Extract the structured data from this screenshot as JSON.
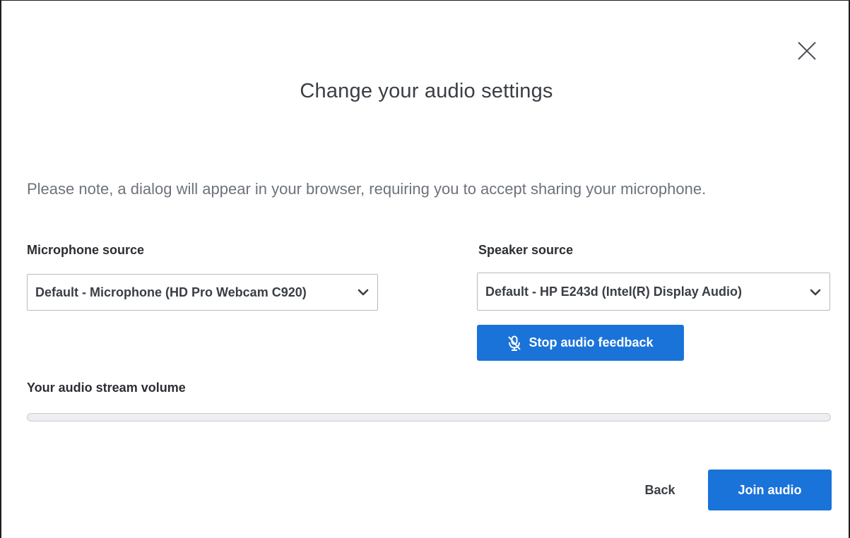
{
  "dialog": {
    "title": "Change your audio settings",
    "note": "Please note, a dialog will appear in your browser, requiring you to accept sharing your microphone.",
    "close_icon": "close-icon"
  },
  "microphone": {
    "label": "Microphone source",
    "selected": "Default - Microphone (HD Pro Webcam C920)",
    "chevron_icon": "chevron-down-icon"
  },
  "speaker": {
    "label": "Speaker source",
    "selected": "Default - HP E243d (Intel(R) Display Audio)",
    "chevron_icon": "chevron-down-icon"
  },
  "feedback_button": {
    "label": "Stop audio feedback",
    "icon": "mic-off-icon"
  },
  "volume": {
    "label": "Your audio stream volume",
    "level": 0
  },
  "footer": {
    "back_label": "Back",
    "join_label": "Join audio"
  },
  "colors": {
    "accent": "#1a73d9",
    "note_text": "#6d737b",
    "border": "#b4bac2"
  }
}
